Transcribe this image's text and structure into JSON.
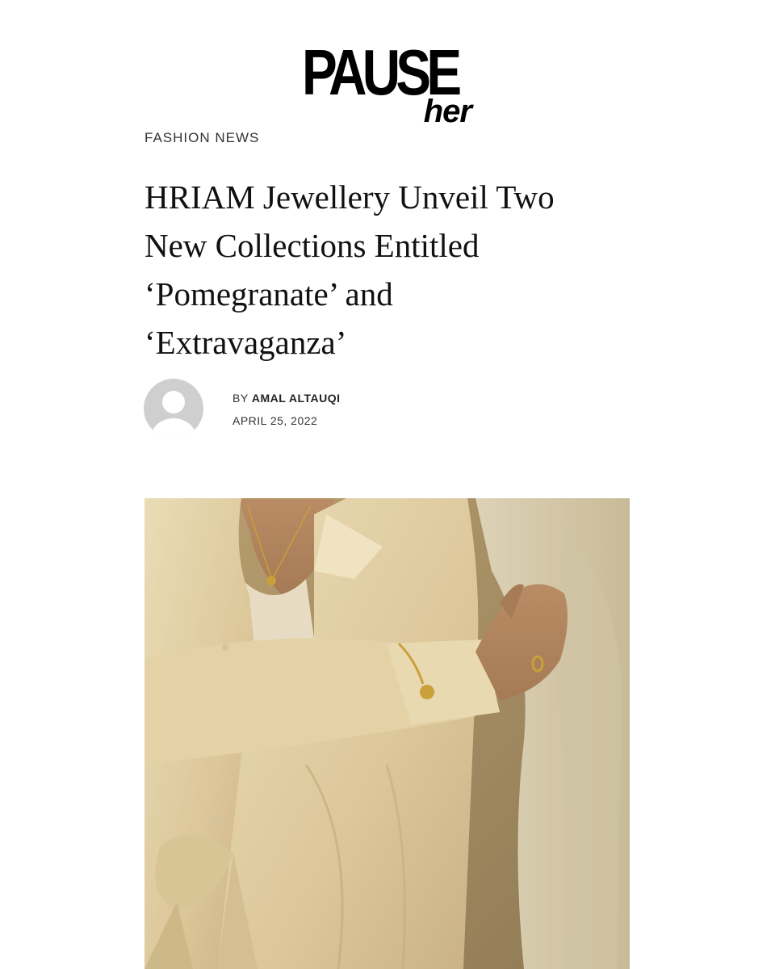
{
  "header": {
    "logo_main": "PAUSE",
    "logo_sub": "her"
  },
  "article": {
    "category": "FASHION NEWS",
    "title_lines": [
      "HRIAM Jewellery Unveil Two",
      "New Collections Entitled",
      "‘Pomegranate’ and",
      "‘Extravaganza’"
    ],
    "byline_prefix": "BY",
    "author": "AMAL ALTAUQI",
    "date": "APRIL 25, 2022"
  },
  "avatar": {
    "icon": "user-placeholder-icon",
    "color": "#cfcfcf"
  },
  "photo": {
    "palette": {
      "background": "#c9b487",
      "shirt": "#e6d4a9",
      "knit": "#d9cdae",
      "skin": "#c0946d",
      "gold": "#c9a03a"
    }
  }
}
